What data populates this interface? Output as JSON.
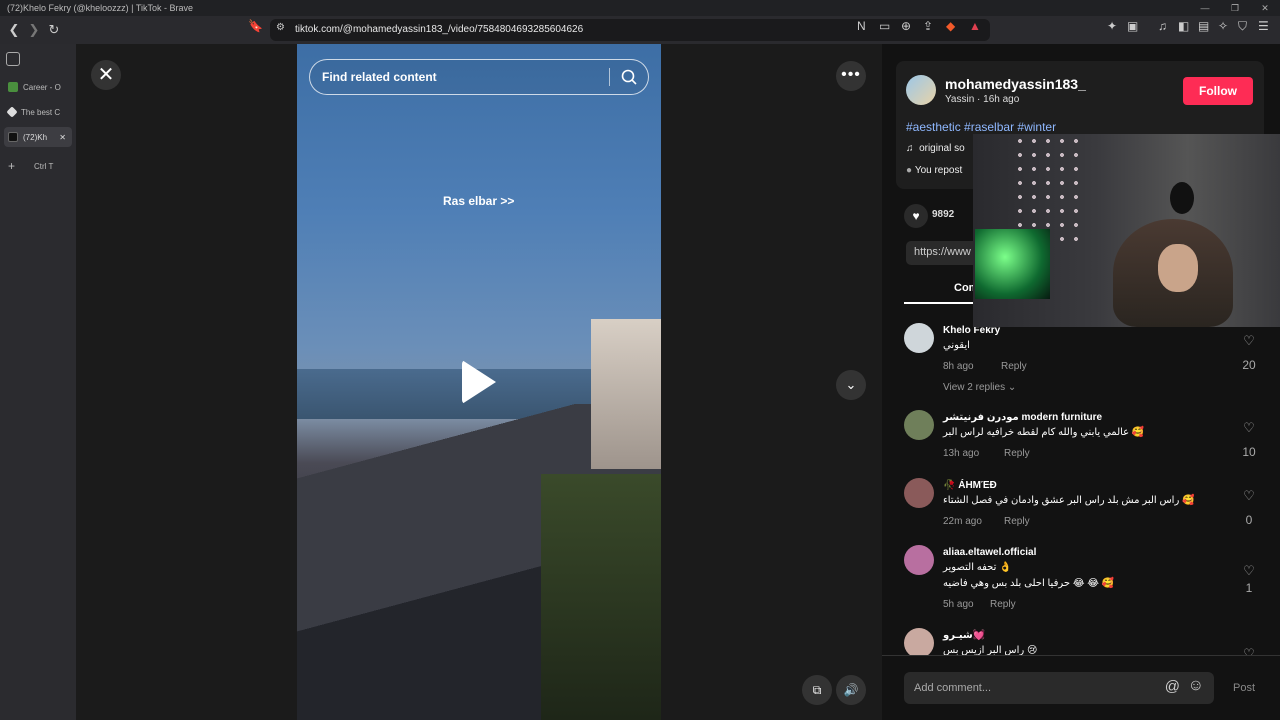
{
  "window": {
    "title": "(72)Khelo Fekry (@kheloozzz) | TikTok - Brave",
    "controls": [
      "—",
      "❐",
      "✕"
    ]
  },
  "browser": {
    "url": "tiktok.com/@mohamedyassin183_/video/7584804693285604626",
    "sidebar_tabs": [
      {
        "label": "Career - O",
        "color": "#4a8f3e"
      },
      {
        "label": "The best C",
        "color": "#dddddd"
      },
      {
        "label": "(72)Kh",
        "color": "#111111"
      }
    ],
    "new_tab_label": "Ctrl  T",
    "tab_close": "✕"
  },
  "video": {
    "search_placeholder": "Find related content",
    "overlay_text": "Ras elbar >>"
  },
  "post": {
    "username": "mohamedyassin183_",
    "meta": "Yassin · 16h ago",
    "follow_label": "Follow",
    "hashtags": "#aesthetic #raselbar #winter",
    "sound": "original so",
    "repost": "You repost",
    "like_count": "9892",
    "link_text": "https://www",
    "comments_tab": "Com"
  },
  "comments": [
    {
      "name": "Khelo Fekry",
      "lines": [
        "ايقوني"
      ],
      "time": "8h ago",
      "reply": "Reply",
      "likes": "20",
      "view_replies": "View 2 replies ⌄",
      "avatar": "#cfd6da"
    },
    {
      "name": "مودرن فرنيتشر modern furniture",
      "lines": [
        "عالمي يابني والله كام لقطه خرافيه لراس البر 🥰"
      ],
      "time": "13h ago",
      "reply": "Reply",
      "likes": "10",
      "avatar": "#6f7f5a"
    },
    {
      "name": "🥀 ÁΗΜΈĐ",
      "lines": [
        "راس البر مش بلد راس البر عشق وادمان في فصل الشتاء 🥰"
      ],
      "time": "22m ago",
      "reply": "Reply",
      "likes": "0",
      "avatar": "#8a5a5a"
    },
    {
      "name": "aliaa.eltawel.official",
      "lines": [
        "تحفه التصوير 👌",
        "حرفيا احلى بلد بس وهي فاضيه 😂 😂 🥰"
      ],
      "time": "5h ago",
      "reply": "Reply",
      "likes": "1",
      "avatar": "#b86fa0"
    },
    {
      "name": "شيـرو💓",
      "lines": [
        "راس البر ازيس بس 😢"
      ],
      "time": "",
      "reply": "",
      "likes": "",
      "avatar": "#c9a9a0"
    }
  ],
  "comment_box": {
    "placeholder": "Add comment...",
    "at": "@",
    "emoji": "☺",
    "post": "Post"
  }
}
